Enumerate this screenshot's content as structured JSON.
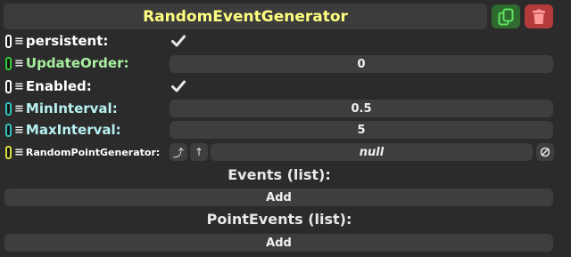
{
  "header": {
    "title": "RandomEventGenerator",
    "duplicate_icon": "duplicate-icon",
    "delete_icon": "trash-icon"
  },
  "fields": {
    "persistent": {
      "label": "persistent:",
      "checked": true,
      "label_color": "#ffffff",
      "connector_color": "#ffffff"
    },
    "update_order": {
      "label": "UpdateOrder:",
      "value": "0",
      "label_color": "#a8f0a0",
      "connector_color": "#33cc33"
    },
    "enabled": {
      "label": "Enabled:",
      "checked": true,
      "label_color": "#ffffff",
      "connector_color": "#ffffff"
    },
    "min_interval": {
      "label": "MinInterval:",
      "value": "0.5",
      "label_color": "#b8f0f0",
      "connector_color": "#33c0c0"
    },
    "max_interval": {
      "label": "MaxInterval:",
      "value": "5",
      "label_color": "#b8f0f0",
      "connector_color": "#33c0c0"
    },
    "random_point_generator": {
      "label": "RandomPointGenerator:",
      "value": "null",
      "label_color": "#ffffff",
      "connector_color": "#d8e040"
    }
  },
  "sections": {
    "events": {
      "title": "Events (list):",
      "add_label": "Add"
    },
    "point_events": {
      "title": "PointEvents (list):",
      "add_label": "Add"
    }
  },
  "colors": {
    "title": "#ffff80",
    "background": "#2b2b2b",
    "field_bg": "#3e3e3e",
    "duplicate_btn": "#2f6a2f",
    "delete_btn": "#b53a3a"
  }
}
